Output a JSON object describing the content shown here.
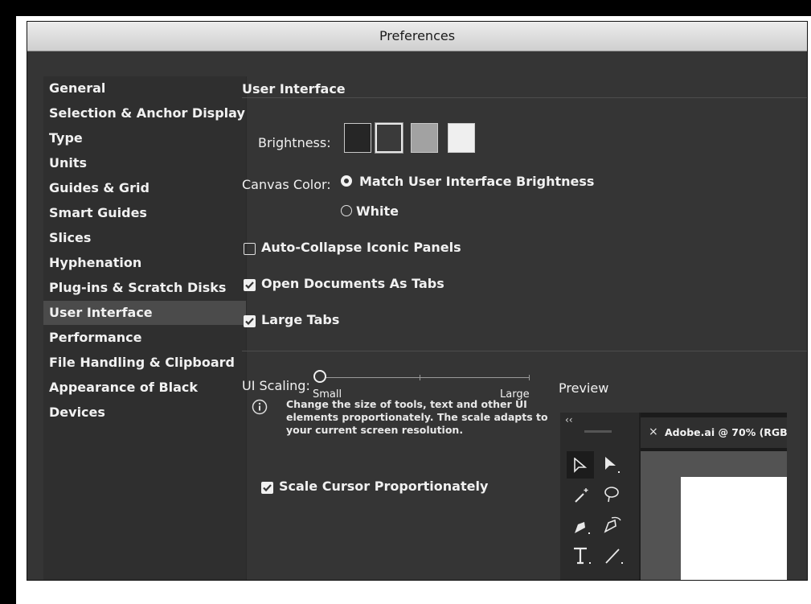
{
  "window": {
    "title": "Preferences"
  },
  "sidebar": {
    "items": [
      {
        "label": "General"
      },
      {
        "label": "Selection & Anchor Display"
      },
      {
        "label": "Type"
      },
      {
        "label": "Units"
      },
      {
        "label": "Guides & Grid"
      },
      {
        "label": "Smart Guides"
      },
      {
        "label": "Slices"
      },
      {
        "label": "Hyphenation"
      },
      {
        "label": "Plug-ins & Scratch Disks"
      },
      {
        "label": "User Interface",
        "active": true
      },
      {
        "label": "Performance"
      },
      {
        "label": "File Handling & Clipboard"
      },
      {
        "label": "Appearance of Black"
      },
      {
        "label": "Devices"
      }
    ]
  },
  "panel": {
    "heading": "User Interface",
    "brightness": {
      "label": "Brightness:",
      "swatches": [
        "#262626",
        "#3a3a3a",
        "#a2a2a2",
        "#efefef"
      ],
      "selected_index": 1
    },
    "canvas_color": {
      "label": "Canvas Color:",
      "options": [
        {
          "label": "Match User Interface Brightness",
          "selected": true
        },
        {
          "label": "White",
          "selected": false
        }
      ]
    },
    "checkboxes": [
      {
        "label": "Auto-Collapse Iconic Panels",
        "checked": false
      },
      {
        "label": "Open Documents As Tabs",
        "checked": true
      },
      {
        "label": "Large Tabs",
        "checked": true
      }
    ],
    "ui_scaling": {
      "label": "UI Scaling:",
      "min_label": "Small",
      "max_label": "Large",
      "value_fraction": 0.0
    },
    "info_icon": "info-circle-icon",
    "info_text": "Change the size of tools, text and other UI elements proportionately. The scale adapts to your current screen resolution.",
    "scale_cursor": {
      "label": "Scale Cursor Proportionately",
      "checked": true
    },
    "preview": {
      "label": "Preview",
      "collapse_glyph": "‹‹",
      "tab_close": "×",
      "tab_title": "Adobe.ai @ 70% (RGB/"
    }
  },
  "colors": {
    "panel_bg": "#353535",
    "sidebar_bg": "#2f2f2f",
    "active_item": "#4b4b4b",
    "text": "#f1f1f1"
  }
}
